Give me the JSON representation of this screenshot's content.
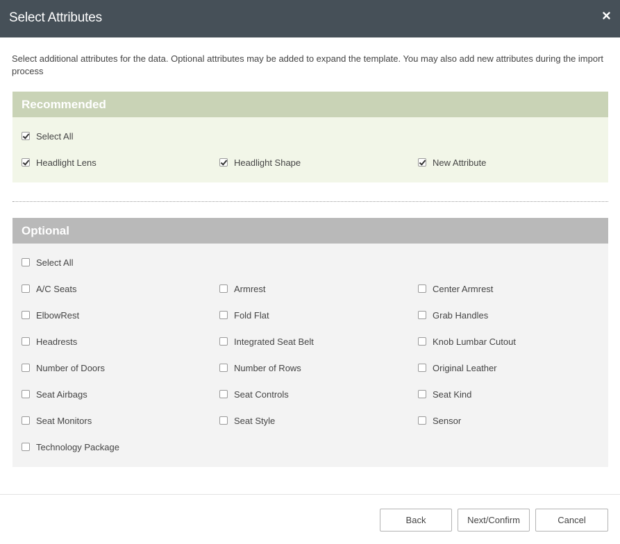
{
  "dialog": {
    "title": "Select Attributes",
    "close_icon": "close-icon",
    "intro": "Select additional attributes for the data. Optional attributes may be added to expand the template. You may also add new attributes during the import process"
  },
  "recommended": {
    "title": "Recommended",
    "select_all": {
      "label": "Select All",
      "checked": true
    },
    "items": [
      {
        "label": "Headlight Lens",
        "checked": true
      },
      {
        "label": "Headlight Shape",
        "checked": true
      },
      {
        "label": "New Attribute",
        "checked": true
      }
    ]
  },
  "optional": {
    "title": "Optional",
    "select_all": {
      "label": "Select All",
      "checked": false
    },
    "items": [
      {
        "label": "A/C Seats",
        "checked": false
      },
      {
        "label": "Armrest",
        "checked": false
      },
      {
        "label": "Center Armrest",
        "checked": false
      },
      {
        "label": "ElbowRest",
        "checked": false
      },
      {
        "label": "Fold Flat",
        "checked": false
      },
      {
        "label": "Grab Handles",
        "checked": false
      },
      {
        "label": "Headrests",
        "checked": false
      },
      {
        "label": "Integrated Seat Belt",
        "checked": false
      },
      {
        "label": "Knob Lumbar Cutout",
        "checked": false
      },
      {
        "label": "Number of Doors",
        "checked": false
      },
      {
        "label": "Number of Rows",
        "checked": false
      },
      {
        "label": "Original Leather",
        "checked": false
      },
      {
        "label": "Seat Airbags",
        "checked": false
      },
      {
        "label": "Seat Controls",
        "checked": false
      },
      {
        "label": "Seat Kind",
        "checked": false
      },
      {
        "label": "Seat Monitors",
        "checked": false
      },
      {
        "label": "Seat Style",
        "checked": false
      },
      {
        "label": "Sensor",
        "checked": false
      },
      {
        "label": "Technology Package",
        "checked": false
      }
    ]
  },
  "footer": {
    "back_label": "Back",
    "next_label": "Next/Confirm",
    "cancel_label": "Cancel"
  },
  "colors": {
    "titlebar": "#465058",
    "recommended_header": "#c9d3b6",
    "recommended_body": "#f2f6e8",
    "optional_header": "#b9b9b9",
    "optional_body": "#f3f3f3"
  }
}
